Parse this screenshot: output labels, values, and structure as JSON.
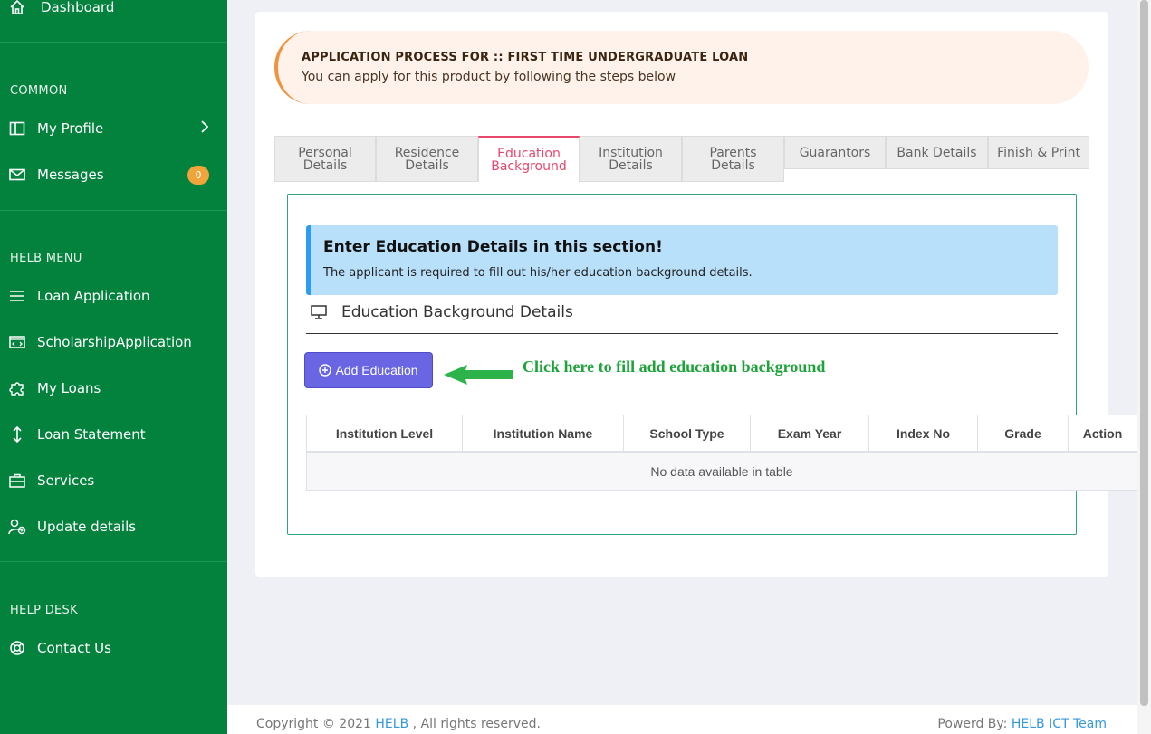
{
  "sidebar": {
    "dashboard": "Dashboard",
    "common_header": "COMMON",
    "my_profile": "My Profile",
    "messages": "Messages",
    "messages_badge": "0",
    "helb_header": "HELB MENU",
    "loan_application": "Loan Application",
    "scholarship_application": "ScholarshipApplication",
    "my_loans": "My Loans",
    "loan_statement": "Loan Statement",
    "services": "Services",
    "update_details": "Update details",
    "helpdesk_header": "HELP DESK",
    "contact_us": "Contact Us"
  },
  "callout": {
    "title": "APPLICATION PROCESS FOR :: FIRST TIME UNDERGRADUATE LOAN",
    "subtitle": "You can apply for this product by following the steps below"
  },
  "tabs": [
    {
      "line1": "Personal",
      "line2": "Details"
    },
    {
      "line1": "Residence",
      "line2": "Details"
    },
    {
      "line1": "Education",
      "line2": "Background"
    },
    {
      "line1": "Institution",
      "line2": "Details"
    },
    {
      "line1": "Parents",
      "line2": "Details"
    },
    {
      "line1": "Guarantors",
      "line2": ""
    },
    {
      "line1": "Bank Details",
      "line2": ""
    },
    {
      "line1": "Finish & Print",
      "line2": ""
    }
  ],
  "info_box": {
    "heading": "Enter Education Details in this section!",
    "text": "The applicant is required to fill out his/her education background details."
  },
  "section_title": "Education Background Details",
  "add_button": "Add Education",
  "hint": "Click here to fill add education background",
  "table": {
    "columns": [
      "Institution Level",
      "Institution Name",
      "School Type",
      "Exam Year",
      "Index No",
      "Grade",
      "Action"
    ],
    "empty": "No data available in table"
  },
  "footer": {
    "copyright": "Copyright © 2021",
    "helb_link": "HELB",
    "rights": ", All rights reserved.",
    "powered": "Powerd By:",
    "team_link": "HELB ICT Team"
  },
  "colors": {
    "sidebar": "#03823e",
    "active_tab": "#e8486b",
    "add_button": "#6a66e3",
    "hint": "#1ea33a"
  }
}
